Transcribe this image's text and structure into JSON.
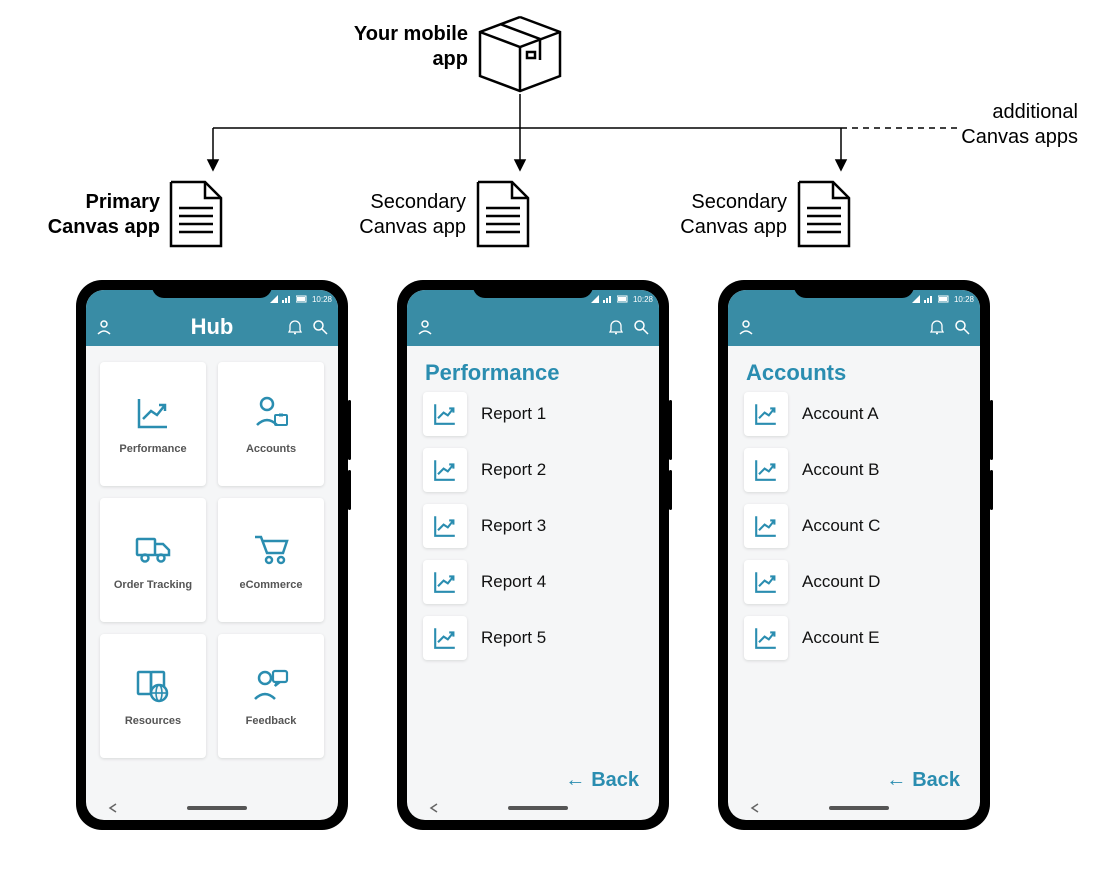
{
  "top": {
    "title_line1": "Your mobile",
    "title_line2": "app",
    "additional_line1": "additional",
    "additional_line2": "Canvas apps"
  },
  "nodes": {
    "primary_line1": "Primary",
    "primary_line2": "Canvas app",
    "secondary1_line1": "Secondary",
    "secondary1_line2": "Canvas app",
    "secondary2_line1": "Secondary",
    "secondary2_line2": "Canvas app"
  },
  "status": {
    "time": "10:28"
  },
  "hub": {
    "title": "Hub",
    "tiles": [
      {
        "label": "Performance",
        "icon": "chart"
      },
      {
        "label": "Accounts",
        "icon": "person-briefcase"
      },
      {
        "label": "Order Tracking",
        "icon": "truck"
      },
      {
        "label": "eCommerce",
        "icon": "cart"
      },
      {
        "label": "Resources",
        "icon": "book-globe"
      },
      {
        "label": "Feedback",
        "icon": "person-chat"
      }
    ]
  },
  "perf": {
    "title": "Performance",
    "items": [
      "Report 1",
      "Report 2",
      "Report 3",
      "Report 4",
      "Report 5"
    ],
    "back": "Back"
  },
  "acct": {
    "title": "Accounts",
    "items": [
      "Account A",
      "Account B",
      "Account C",
      "Account D",
      "Account E"
    ],
    "back": "Back"
  },
  "colors": {
    "accent": "#2a8db0",
    "header": "#398ca5"
  }
}
